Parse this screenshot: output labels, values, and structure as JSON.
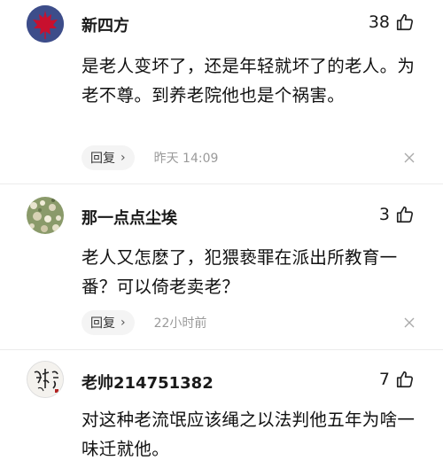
{
  "comments": [
    {
      "username": "新四方",
      "likes": "38",
      "text": "是老人变坏了，还是年轻就坏了的老人。为老不尊。到养老院他也是个祸害。",
      "reply_label": "回复",
      "reply_chevron": "›",
      "time": "昨天 14:09",
      "avatar": "red-maple-leaf"
    },
    {
      "username": "那一点点尘埃",
      "likes": "3",
      "text": "老人又怎麽了，犯猥亵罪在派出所教育一番？可以倚老卖老？",
      "reply_label": "回复",
      "reply_chevron": "›",
      "time": "22小时前",
      "avatar": "flower-photo"
    },
    {
      "username": "老帅214751382",
      "likes": "7",
      "text": "对这种老流氓应该绳之以法判他五年为啥一味迁就他。",
      "avatar": "calligraphy"
    }
  ],
  "colors": {
    "background": "#ffffff",
    "reply_bg": "#f4f4f4",
    "time_text": "#9a9a9a",
    "divider": "#ececec",
    "avatar_maple_bg": "#3d4d8a",
    "maple_leaf": "#c8102e"
  },
  "icons": [
    "thumbs-up-icon",
    "close-icon",
    "chevron-right-icon"
  ]
}
